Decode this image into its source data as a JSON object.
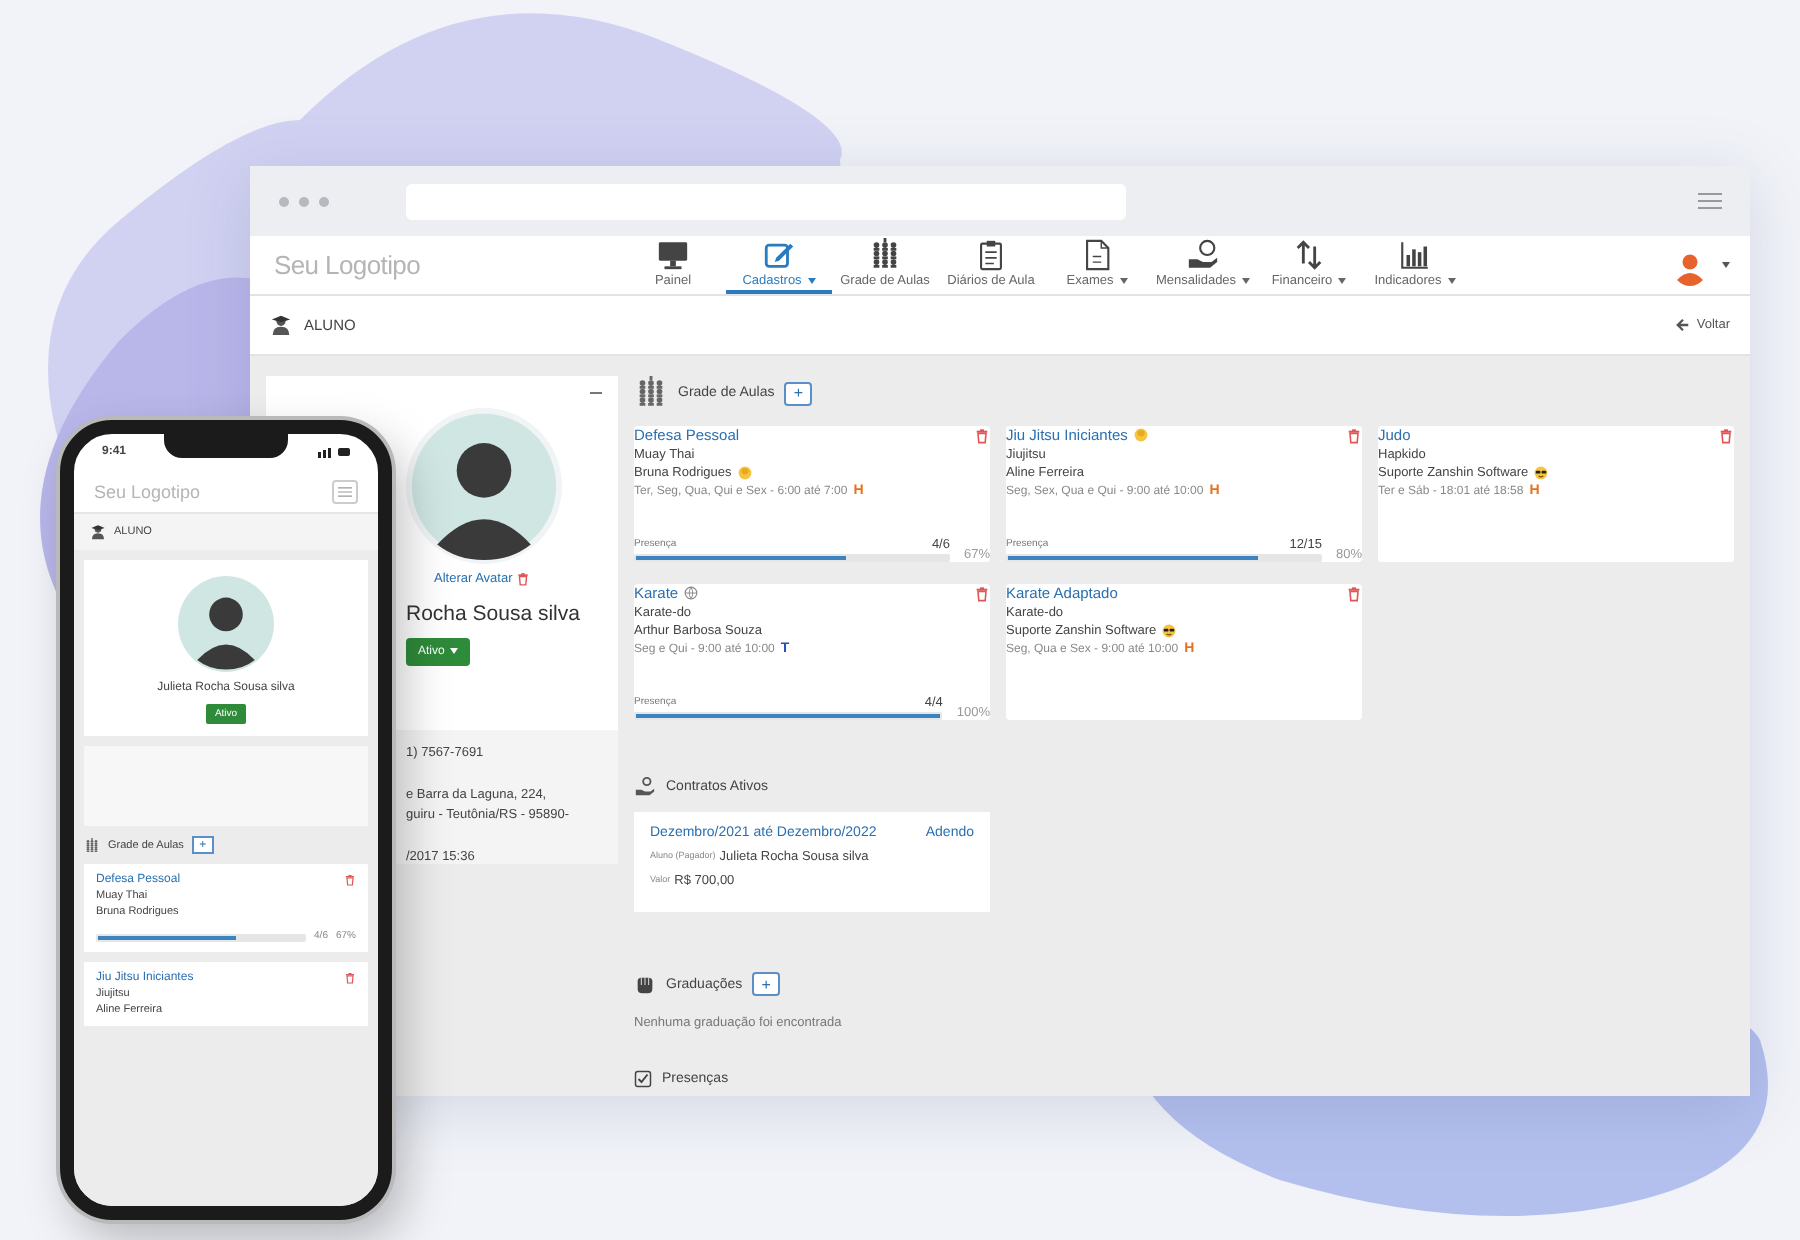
{
  "nav": {
    "logo": "Seu Logotipo",
    "items": [
      {
        "label": "Painel",
        "kind": "monitor",
        "selected": false,
        "dropdown": false
      },
      {
        "label": "Cadastros",
        "kind": "edit",
        "selected": true,
        "dropdown": true
      },
      {
        "label": "Grade de Aulas",
        "kind": "people",
        "selected": false,
        "dropdown": false
      },
      {
        "label": "Diários de Aula",
        "kind": "clipboard",
        "selected": false,
        "dropdown": false
      },
      {
        "label": "Exames",
        "kind": "document",
        "selected": false,
        "dropdown": true
      },
      {
        "label": "Mensalidades",
        "kind": "money",
        "selected": false,
        "dropdown": true
      },
      {
        "label": "Financeiro",
        "kind": "arrows",
        "selected": false,
        "dropdown": true
      },
      {
        "label": "Indicadores",
        "kind": "chart",
        "selected": false,
        "dropdown": true
      }
    ]
  },
  "page_header": {
    "title": "ALUNO",
    "back": "Voltar"
  },
  "profile": {
    "avatar_link": "Alterar Avatar",
    "name": "Rocha Sousa silva",
    "status": "Ativo",
    "phone": "1) 7567-7691",
    "address_lines": [
      "e Barra da Laguna, 224,",
      "guiru - Teutônia/RS - 95890-"
    ],
    "registered": "/2017 15:36"
  },
  "classes": {
    "title": "Grade de Aulas",
    "add": "+",
    "cards": [
      {
        "title": "Defesa Pessoal",
        "modality": "Muay Thai",
        "teacher": "Bruna Rodrigues",
        "teacher_icon": {
          "kind": "hand"
        },
        "schedule": "Ter, Seg, Qua, Qui e Sex - 6:00 até 7:00",
        "badge": {
          "text": "H",
          "color": "#e8711c"
        },
        "presence": {
          "label": "Presença",
          "count": "4/6",
          "percent": "67%",
          "level": 0.67
        }
      },
      {
        "title": "Jiu Jitsu Iniciantes",
        "title_icon": {
          "kind": "hand"
        },
        "modality": "Jiujitsu",
        "teacher": "Aline Ferreira",
        "schedule": "Seg, Sex, Qua e Qui - 9:00 até 10:00",
        "badge": {
          "text": "H",
          "color": "#e8711c"
        },
        "presence": {
          "label": "Presença",
          "count": "12/15",
          "percent": "80%",
          "level": 0.8
        }
      },
      {
        "title": "Judo",
        "modality": "Hapkido",
        "teacher": "Suporte Zanshin Software",
        "teacher_icon": {
          "kind": "sunglasses"
        },
        "schedule": "Ter e Sáb - 18:01 até 18:58",
        "badge": {
          "text": "H",
          "color": "#e8711c"
        }
      },
      {
        "title": "Karate",
        "title_icon": {
          "kind": "globe"
        },
        "modality": "Karate-do",
        "teacher": "Arthur Barbosa Souza",
        "schedule": "Seg e Qui - 9:00 até 10:00",
        "badge": {
          "text": "T",
          "color": "#2a4fb5"
        },
        "presence": {
          "label": "Presença",
          "count": "4/4",
          "percent": "100%",
          "level": 1
        }
      },
      {
        "title": "Karate Adaptado",
        "modality": "Karate-do",
        "teacher": "Suporte Zanshin Software",
        "teacher_icon": {
          "kind": "sunglasses"
        },
        "schedule": "Seg, Qua e Sex - 9:00 até 10:00",
        "badge": {
          "text": "H",
          "color": "#e8711c"
        }
      }
    ]
  },
  "contracts": {
    "title": "Contratos Ativos",
    "items": [
      {
        "period": "Dezembro/2021 até Dezembro/2022",
        "action": "Adendo",
        "payer_label": "Aluno (Pagador)",
        "payer": "Julieta Rocha Sousa silva",
        "value_label": "Valor",
        "value": "R$ 700,00"
      }
    ]
  },
  "graduations": {
    "title": "Graduações",
    "add": "+",
    "empty": "Nenhuma graduação foi encontrada"
  },
  "attendance": {
    "title": "Presenças"
  },
  "phone": {
    "time": "9:41",
    "logo": "Seu Logotipo",
    "header": "ALUNO",
    "name": "Julieta Rocha Sousa silva",
    "status": "Ativo",
    "section": "Grade de Aulas",
    "add": "+",
    "cards": [
      {
        "title": "Defesa Pessoal",
        "modality": "Muay Thai",
        "teacher": "Bruna Rodrigues",
        "presence": {
          "count": "4/6",
          "percent": "67%",
          "level": 0.67
        }
      },
      {
        "title": "Jiu Jitsu Iniciantes",
        "modality": "Jiujitsu",
        "teacher": "Aline Ferreira"
      }
    ]
  }
}
